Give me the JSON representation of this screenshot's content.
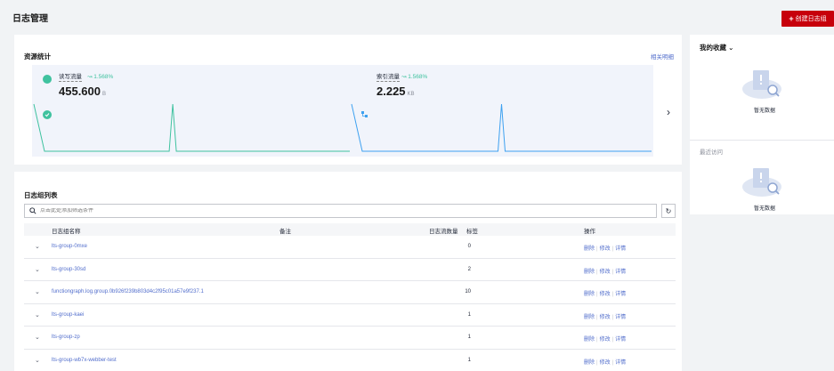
{
  "page": {
    "title": "日志管理",
    "create_button": "创建日志组"
  },
  "stats": {
    "title": "资源统计",
    "detail_link": "相关明细",
    "metrics": [
      {
        "label": "读写流量",
        "trend": "1.568%",
        "value": "455.600",
        "unit": "B",
        "color": "#3fc29f",
        "peaks": [
          0.0,
          0.43,
          1.0
        ]
      },
      {
        "label": "索引流量",
        "trend": "1.568%",
        "value": "2.225",
        "unit": "KB",
        "color": "#3ea1f0",
        "peaks": [
          0.0,
          0.5,
          1.0
        ]
      }
    ],
    "next_icon": "chevron-right-icon"
  },
  "list": {
    "title": "日志组列表",
    "search_placeholder": "点击此处添加筛选条件",
    "columns": [
      "日志组名称",
      "备注",
      "日志流数量",
      "标签",
      "操作"
    ],
    "rows": [
      {
        "name": "lts-group-0mxe",
        "count": "0"
      },
      {
        "name": "lts-group-30sd",
        "count": "2"
      },
      {
        "name": "functiongraph.log.group.0b926f239b803d4c2f95c01a57e9f237.1",
        "count": "10"
      },
      {
        "name": "lts-group-kaei",
        "count": "1"
      },
      {
        "name": "lts-group-zp",
        "count": "1"
      },
      {
        "name": "lts-group-wb7x-webber-test",
        "count": "1"
      }
    ],
    "ops": {
      "delete": "删除",
      "edit": "修改",
      "detail": "详情"
    }
  },
  "favorites": {
    "title": "我的收藏",
    "empty": "暂无数据"
  },
  "recent": {
    "title": "最近访问",
    "empty": "暂无数据"
  }
}
